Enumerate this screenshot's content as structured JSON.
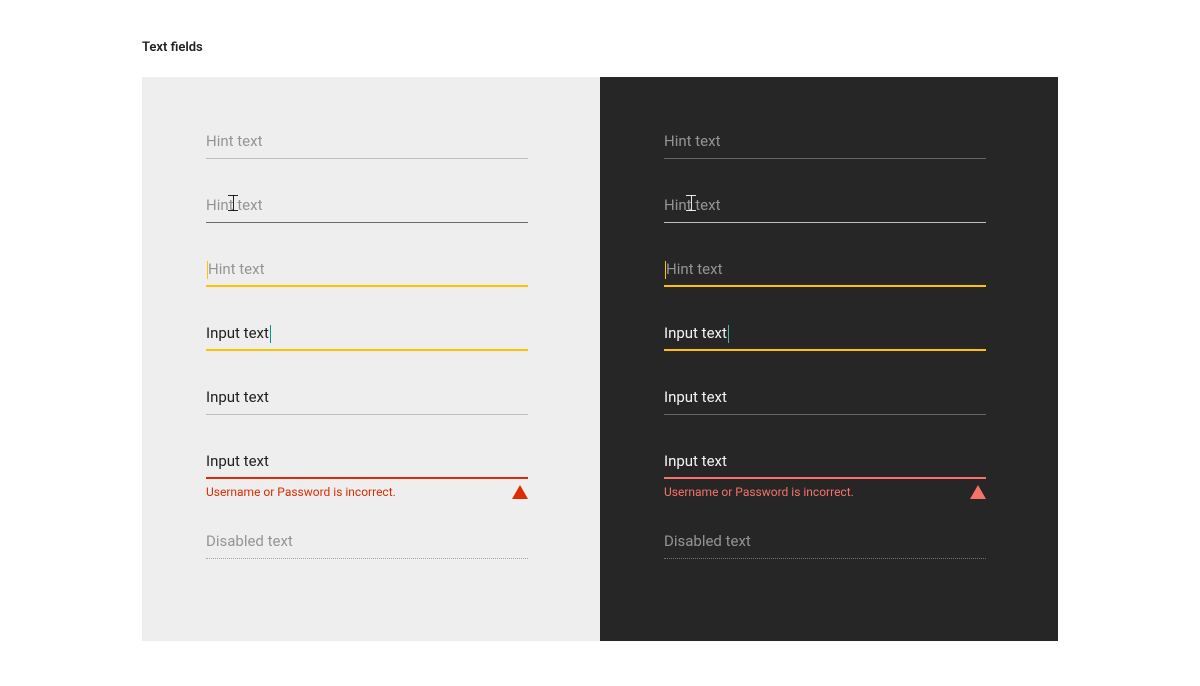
{
  "title": "Text fields",
  "colors": {
    "accent": "#FFC107",
    "error_light": "#DD2C00",
    "error_dark": "#F77268",
    "panel_light": "#EEEEEE",
    "panel_dark": "#262626",
    "caret_input_light": "#009688",
    "caret_input_dark": "#4DB6AC"
  },
  "light": {
    "idle": {
      "placeholder": "Hint text"
    },
    "hover": {
      "placeholder": "Hint text"
    },
    "press": {
      "placeholder": "Hint text"
    },
    "focus": {
      "value": "Input text"
    },
    "filled": {
      "value": "Input text"
    },
    "error": {
      "value": "Input text",
      "message": "Username or Password is incorrect."
    },
    "disabled": {
      "value": "Disabled text"
    }
  },
  "dark": {
    "idle": {
      "placeholder": "Hint text"
    },
    "hover": {
      "placeholder": "Hint text"
    },
    "press": {
      "placeholder": "Hint text"
    },
    "focus": {
      "value": "Input text"
    },
    "filled": {
      "value": "Input text"
    },
    "error": {
      "value": "Input text",
      "message": "Username or Password is incorrect."
    },
    "disabled": {
      "value": "Disabled text"
    }
  }
}
